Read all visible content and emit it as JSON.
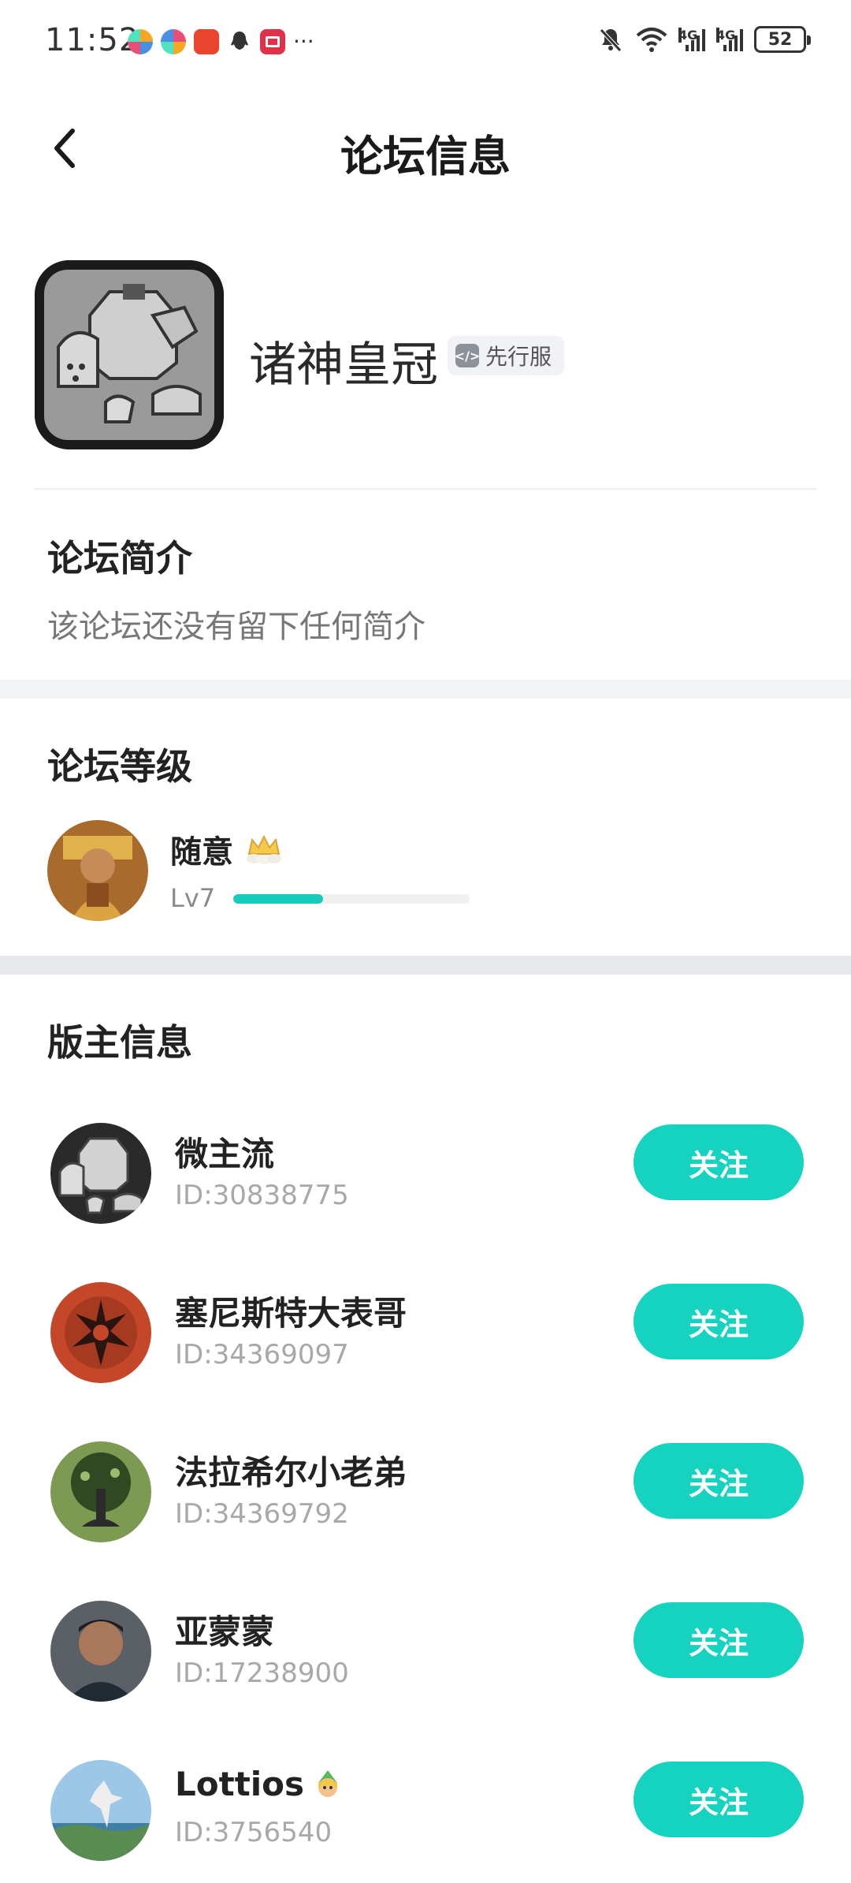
{
  "status_bar": {
    "time": "11:52",
    "battery": "52",
    "network_1": "4G",
    "network_2": "4G",
    "more": "···"
  },
  "header": {
    "title": "论坛信息",
    "back_icon": "chevron-left-icon"
  },
  "forum": {
    "name": "诸神皇冠",
    "tag": "先行服",
    "tag_icon": "code-icon"
  },
  "intro": {
    "title": "论坛简介",
    "text": "该论坛还没有留下任何简介"
  },
  "level": {
    "title": "论坛等级",
    "user": "随意",
    "lv": "Lv7",
    "progress": 0.38
  },
  "moderators": {
    "title": "版主信息",
    "follow_label": "关注",
    "items": [
      {
        "name": "微主流",
        "id": "ID:30838775"
      },
      {
        "name": "塞尼斯特大表哥",
        "id": "ID:34369097"
      },
      {
        "name": "法拉希尔小老弟",
        "id": "ID:34369792"
      },
      {
        "name": "亚蒙蒙",
        "id": "ID:17238900"
      },
      {
        "name": "Lottios",
        "id": "ID:3756540"
      }
    ]
  },
  "colors": {
    "accent": "#16d3c0",
    "band": "#f2f3f5"
  }
}
